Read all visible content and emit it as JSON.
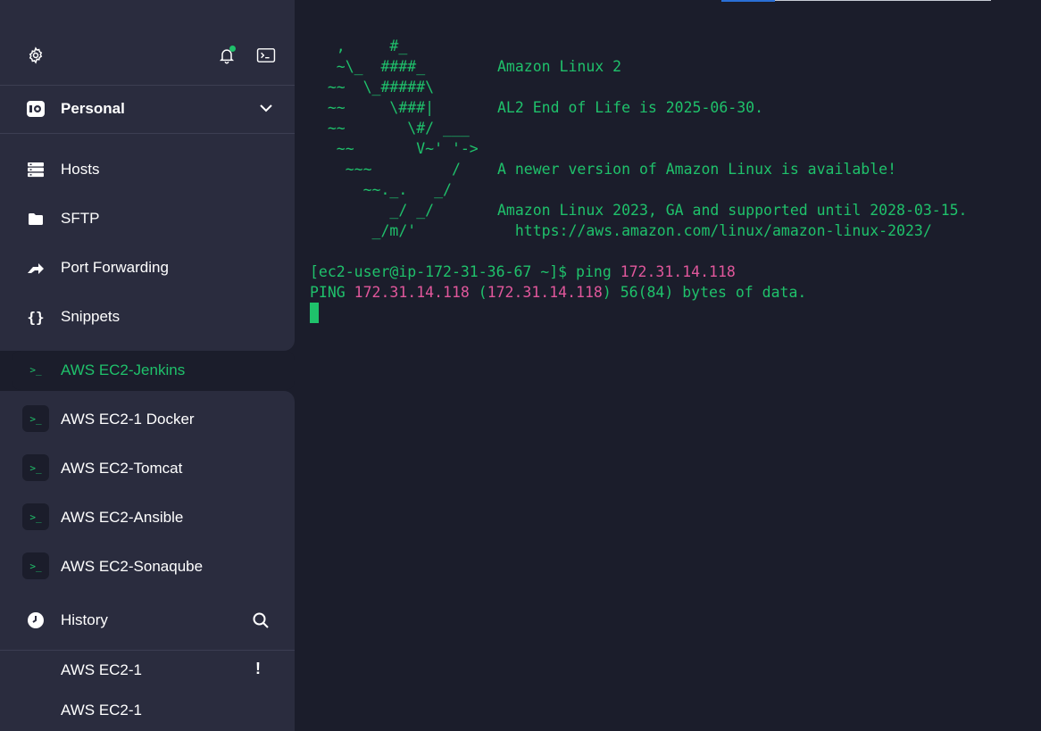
{
  "sidebar": {
    "toolbar": {
      "settings_icon": "gear-icon",
      "notifications_icon": "bell-icon",
      "terminal_icon": "terminal-icon"
    },
    "vault": {
      "label": "Personal",
      "icon": "vault-icon"
    },
    "nav": [
      {
        "label": "Hosts",
        "icon": "server-icon"
      },
      {
        "label": "SFTP",
        "icon": "folder-icon"
      },
      {
        "label": "Port Forwarding",
        "icon": "forward-icon"
      },
      {
        "label": "Snippets",
        "icon": "braces-icon"
      }
    ],
    "hosts": [
      {
        "label": "AWS EC2-Jenkins",
        "active": true
      },
      {
        "label": "AWS EC2-1 Docker"
      },
      {
        "label": "AWS EC2-Tomcat"
      },
      {
        "label": "AWS EC2-Ansible"
      },
      {
        "label": "AWS EC2-Sonaqube"
      }
    ],
    "history": {
      "label": "History",
      "items": [
        {
          "label": "AWS EC2-1",
          "warning": "!"
        },
        {
          "label": "AWS EC2-1",
          "warning": ""
        }
      ]
    }
  },
  "terminal": {
    "banner_art": [
      "   ,     #_",
      "   ~\\_  ####_",
      "  ~~  \\_#####\\",
      "  ~~     \\###|",
      "  ~~       \\#/ ___",
      "   ~~       V~' '->",
      "    ~~~         /",
      "      ~~._.   _/",
      "         _/ _/",
      "       _/m/'"
    ],
    "banner_text": [
      "Amazon Linux 2",
      "",
      "AL2 End of Life is 2025-06-30.",
      "",
      "",
      "A newer version of Amazon Linux is available!",
      "",
      "Amazon Linux 2023, GA and supported until 2028-03-15.",
      "  https://aws.amazon.com/linux/amazon-linux-2023/"
    ],
    "prompt": "[ec2-user@ip-172-31-36-67 ~]$ ping ",
    "prompt_ip": "172.31.14.118",
    "output_prefix": "PING ",
    "output_ip1": "172.31.14.118",
    "output_mid": " (",
    "output_ip2": "172.31.14.118",
    "output_suffix": ") 56(84) bytes of data."
  },
  "colors": {
    "accent_green": "#1fc16b",
    "ip_pink": "#e0579b",
    "sidebar_bg": "#2a2c3e",
    "terminal_bg": "#1b1d2b"
  }
}
